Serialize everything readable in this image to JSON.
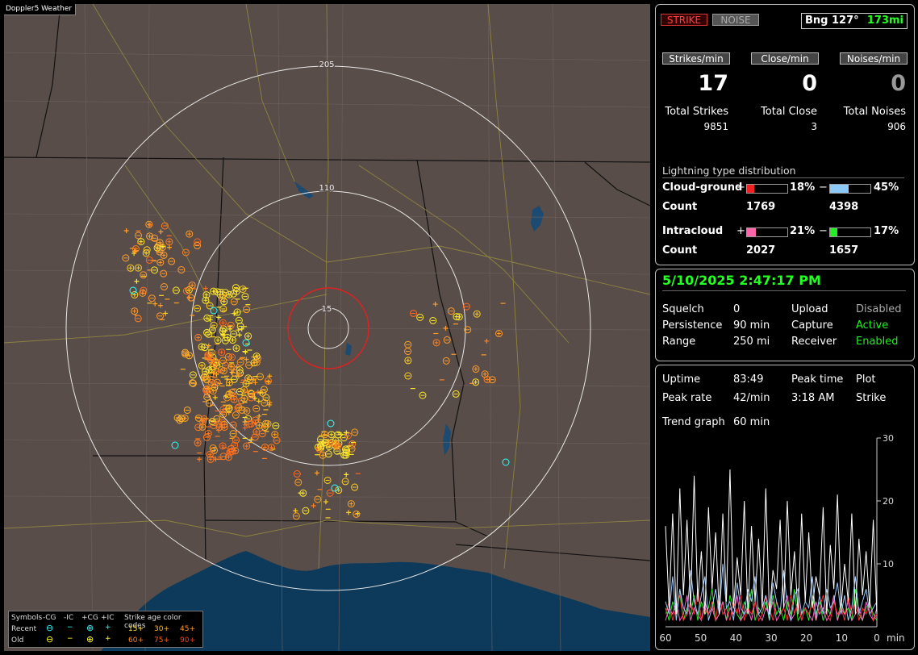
{
  "app_title": "Doppler5 Weather",
  "map": {
    "range_labels": [
      "205",
      "110",
      "15"
    ],
    "legend": {
      "symbols_label": "Symbols",
      "neg_cg": "-CG",
      "neg_ic": "-IC",
      "pos_cg": "+CG",
      "pos_ic": "+IC",
      "age_title": "Strike age color codes",
      "recent_label": "Recent",
      "old_label": "Old",
      "recent_ages": [
        "15+",
        "30+",
        "45+"
      ],
      "old_ages": [
        "60+",
        "75+",
        "90+"
      ]
    }
  },
  "strike_panel": {
    "strike_btn": "STRIKE",
    "noise_btn": "NOISE",
    "bearing": "Bng 127°",
    "distance": "173mi",
    "rates": [
      {
        "label": "Strikes/min",
        "value": "17",
        "total_label": "Total Strikes",
        "total": "9851"
      },
      {
        "label": "Close/min",
        "value": "0",
        "total_label": "Total Close",
        "total": "3"
      },
      {
        "label": "Noises/min",
        "value": "0",
        "total_label": "Total Noises",
        "total": "906"
      }
    ],
    "dist_title": "Lightning type distribution",
    "cloud_ground": {
      "label": "Cloud-ground",
      "plus": "+",
      "minus": "−",
      "pos_pct": "18%",
      "neg_pct": "45%",
      "pos_fill": 0.18,
      "neg_fill": 0.45
    },
    "cg_count": {
      "label": "Count",
      "pos": "1769",
      "neg": "4398"
    },
    "intracloud": {
      "label": "Intracloud",
      "plus": "+",
      "minus": "−",
      "pos_pct": "21%",
      "neg_pct": "17%",
      "pos_fill": 0.21,
      "neg_fill": 0.17
    },
    "ic_count": {
      "label": "Count",
      "pos": "2027",
      "neg": "1657"
    }
  },
  "status_panel": {
    "datetime": "5/10/2025 2:47:17 PM",
    "rows": [
      {
        "k1": "Squelch",
        "v1": "0",
        "k2": "Upload",
        "v2": "Disabled"
      },
      {
        "k1": "Persistence",
        "v1": "90 min",
        "k2": "Capture",
        "v2": "Active"
      },
      {
        "k1": "Range",
        "v1": "250 mi",
        "k2": "Receiver",
        "v2": "Enabled"
      }
    ]
  },
  "stats_panel": {
    "uptime_label": "Uptime",
    "uptime": "83:49",
    "peak_time_label": "Peak time",
    "peak_time": "3:18 AM",
    "plot_label": "Plot",
    "plot_value": "Strike",
    "peak_rate_label": "Peak rate",
    "peak_rate": "42/min",
    "trend_label": "Trend graph",
    "trend_value": "60 min"
  },
  "chart_data": {
    "type": "line",
    "x_ticks": [
      "60",
      "50",
      "40",
      "30",
      "20",
      "10",
      "0"
    ],
    "x_unit": "min",
    "y_ticks": [
      "10",
      "20",
      "30"
    ],
    "ylim": [
      0,
      30
    ],
    "series_colors": [
      "#ffffff",
      "#9cc8ff",
      "#ff3030",
      "#ff66cc",
      "#22ee22"
    ],
    "series": [
      {
        "values": [
          16,
          3,
          18,
          2,
          22,
          5,
          17,
          3,
          24,
          4,
          12,
          2,
          19,
          6,
          15,
          2,
          18,
          4,
          25,
          3,
          11,
          5,
          20,
          2,
          16,
          4,
          14,
          3,
          22,
          2,
          9,
          6,
          17,
          3,
          20,
          5,
          12,
          2,
          18,
          4,
          15,
          3,
          8,
          5,
          19,
          2,
          13,
          6,
          21,
          3,
          10,
          4,
          18,
          2,
          14,
          5,
          12,
          3,
          17,
          2
        ]
      },
      {
        "values": [
          4,
          2,
          8,
          1,
          6,
          3,
          2,
          9,
          4,
          2,
          5,
          8,
          1,
          3,
          6,
          2,
          10,
          3,
          4,
          1,
          7,
          3,
          2,
          6,
          4,
          8,
          2,
          3,
          5,
          1,
          7,
          4,
          2,
          9,
          3,
          1,
          5,
          6,
          2,
          4,
          3,
          8,
          1,
          5,
          2,
          6,
          3,
          4,
          7,
          2,
          5,
          1,
          3,
          8,
          2,
          4,
          6,
          2,
          3,
          4
        ]
      },
      {
        "values": [
          2,
          4,
          1,
          3,
          5,
          1,
          2,
          4,
          2,
          6,
          1,
          3,
          2,
          4,
          1,
          5,
          2,
          3,
          1,
          4,
          2,
          5,
          1,
          3,
          2,
          4,
          1,
          2,
          5,
          3,
          1,
          4,
          2,
          3,
          1,
          5,
          2,
          4,
          1,
          3,
          2,
          4,
          1,
          3,
          5,
          2,
          1,
          4,
          2,
          3,
          1,
          5,
          2,
          4,
          1,
          3,
          2,
          4,
          1,
          2
        ]
      },
      {
        "values": [
          1,
          3,
          2,
          4,
          1,
          2,
          5,
          1,
          3,
          2,
          1,
          4,
          2,
          3,
          1,
          2,
          4,
          1,
          3,
          2,
          5,
          1,
          2,
          3,
          1,
          4,
          2,
          1,
          3,
          2,
          4,
          1,
          2,
          3,
          5,
          1,
          2,
          4,
          1,
          3,
          2,
          1,
          4,
          2,
          3,
          1,
          2,
          5,
          1,
          3,
          2,
          4,
          1,
          2,
          3,
          1,
          4,
          2,
          1,
          3
        ]
      },
      {
        "values": [
          3,
          1,
          4,
          2,
          6,
          1,
          3,
          2,
          5,
          1,
          4,
          2,
          3,
          6,
          1,
          2,
          4,
          1,
          5,
          3,
          2,
          1,
          4,
          2,
          6,
          1,
          3,
          2,
          4,
          1,
          5,
          2,
          3,
          1,
          4,
          2,
          6,
          1,
          2,
          3,
          1,
          5,
          2,
          4,
          1,
          3,
          2,
          5,
          1,
          4,
          2,
          3,
          1,
          6,
          2,
          1,
          3,
          4,
          2,
          1
        ]
      }
    ]
  }
}
